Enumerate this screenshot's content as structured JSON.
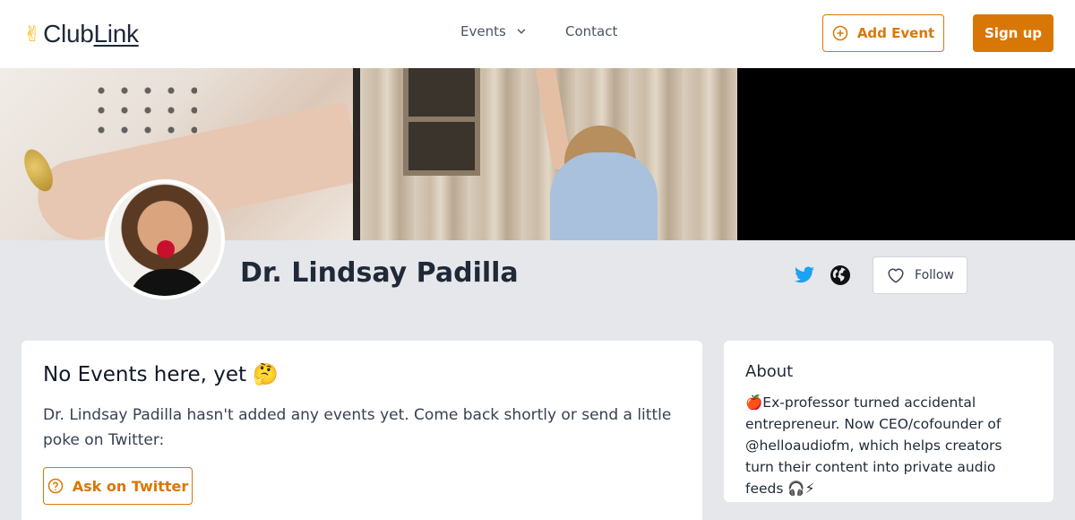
{
  "header": {
    "logo_text_a": "Club",
    "logo_text_b": "Link",
    "nav_events": "Events",
    "nav_contact": "Contact",
    "add_event_label": "Add Event",
    "signup_label": "Sign up"
  },
  "banner": {
    "panel3_color": "#000000"
  },
  "profile": {
    "name": "Dr. Lindsay Padilla",
    "follow_label": "Follow"
  },
  "events_card": {
    "title": "No Events here, yet 🤔",
    "text": "Dr. Lindsay Padilla hasn't added any events yet. Come back shortly or send a little poke on Twitter:",
    "ask_label": "Ask on Twitter"
  },
  "about_card": {
    "title": "About",
    "text": "🍎Ex-professor turned accidental entrepreneur. Now CEO/cofounder of @helloaudiofm, which helps creators turn their content into private audio feeds 🎧⚡"
  },
  "colors": {
    "accent": "#d97706",
    "twitter": "#1da1f2",
    "background": "#e5e7eb"
  },
  "icons": [
    "victory-hand-icon",
    "chevron-down-icon",
    "plus-circle-icon",
    "twitter-icon",
    "globe-icon",
    "heart-icon",
    "question-circle-icon"
  ]
}
